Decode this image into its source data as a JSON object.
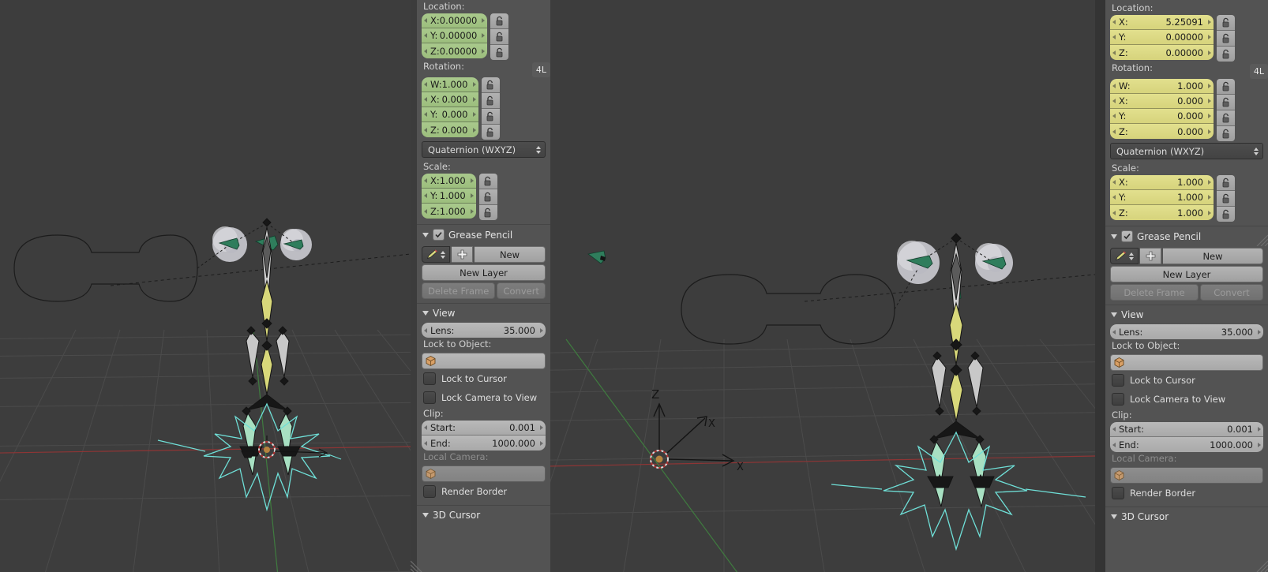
{
  "app": {
    "name": "Blender 3D Viewport",
    "theme_bg": "#3d3d3d",
    "panel_bg": "#535353"
  },
  "panel_left": {
    "location": {
      "label": "Location:",
      "fields": [
        {
          "name": "X:",
          "value": "0.00000"
        },
        {
          "name": "Y:",
          "value": "0.00000"
        },
        {
          "name": "Z:",
          "value": "0.00000"
        }
      ],
      "color": "green"
    },
    "rotation": {
      "label": "Rotation:",
      "fields": [
        {
          "name": "W:",
          "value": "1.000"
        },
        {
          "name": "X:",
          "value": "0.000"
        },
        {
          "name": "Y:",
          "value": "0.000"
        },
        {
          "name": "Z:",
          "value": "0.000"
        }
      ],
      "color": "green",
      "mode": "Quaternion (WXYZ)",
      "layer_button": "4L"
    },
    "scale": {
      "label": "Scale:",
      "fields": [
        {
          "name": "X:",
          "value": "1.000"
        },
        {
          "name": "Y:",
          "value": "1.000"
        },
        {
          "name": "Z:",
          "value": "1.000"
        }
      ],
      "color": "green"
    },
    "grease_pencil": {
      "title": "Grease Pencil",
      "checked": true,
      "new_button": "New",
      "new_layer_button": "New Layer",
      "delete_frame_button": "Delete Frame",
      "convert_button": "Convert"
    },
    "view": {
      "title": "View",
      "lens_label": "Lens:",
      "lens_value": "35.000",
      "lock_to_object_label": "Lock to Object:",
      "lock_to_object_value": "",
      "lock_to_cursor": "Lock to Cursor",
      "lock_camera_to_view": "Lock Camera to View",
      "clip_label": "Clip:",
      "clip_start_label": "Start:",
      "clip_start_value": "0.001",
      "clip_end_label": "End:",
      "clip_end_value": "1000.000",
      "local_camera_label": "Local Camera:",
      "local_camera_value": "",
      "render_border": "Render Border"
    },
    "cursor3d": {
      "title": "3D Cursor"
    }
  },
  "panel_right": {
    "location": {
      "label": "Location:",
      "fields": [
        {
          "name": "X:",
          "value": "5.25091"
        },
        {
          "name": "Y:",
          "value": "0.00000"
        },
        {
          "name": "Z:",
          "value": "0.00000"
        }
      ],
      "color": "yellow"
    },
    "rotation": {
      "label": "Rotation:",
      "fields": [
        {
          "name": "W:",
          "value": "1.000"
        },
        {
          "name": "X:",
          "value": "0.000"
        },
        {
          "name": "Y:",
          "value": "0.000"
        },
        {
          "name": "Z:",
          "value": "0.000"
        }
      ],
      "color": "yellow",
      "mode": "Quaternion (WXYZ)",
      "layer_button": "4L"
    },
    "scale": {
      "label": "Scale:",
      "fields": [
        {
          "name": "X:",
          "value": "1.000"
        },
        {
          "name": "Y:",
          "value": "1.000"
        },
        {
          "name": "Z:",
          "value": "1.000"
        }
      ],
      "color": "yellow"
    },
    "grease_pencil": {
      "title": "Grease Pencil",
      "checked": true,
      "new_button": "New",
      "new_layer_button": "New Layer",
      "delete_frame_button": "Delete Frame",
      "convert_button": "Convert"
    },
    "view": {
      "title": "View",
      "lens_label": "Lens:",
      "lens_value": "35.000",
      "lock_to_object_label": "Lock to Object:",
      "lock_to_object_value": "",
      "lock_to_cursor": "Lock to Cursor",
      "lock_camera_to_view": "Lock Camera to View",
      "clip_label": "Clip:",
      "clip_start_label": "Start:",
      "clip_start_value": "0.001",
      "clip_end_label": "End:",
      "clip_end_value": "1000.000",
      "local_camera_label": "Local Camera:",
      "local_camera_value": "",
      "render_border": "Render Border"
    },
    "cursor3d": {
      "title": "3D Cursor"
    }
  },
  "viewport_left": {
    "grid_color": "#4a4a4a",
    "axis_x_color": "#9c3b3b",
    "axis_y_color": "#3d7a3d",
    "bone_green": "#9fd9b8",
    "bone_yellow": "#d8d87a",
    "widget_cyan": "#6fe0d8"
  },
  "viewport_right": {
    "grid_color": "#4a4a4a",
    "axis_x_color": "#9c3b3b",
    "axis_y_color": "#3d7a3d",
    "axis_label_z": "Z",
    "axis_label_x": "X",
    "bone_green": "#9fd9b8",
    "bone_yellow": "#d8d87a",
    "widget_cyan": "#6fe0d8"
  }
}
